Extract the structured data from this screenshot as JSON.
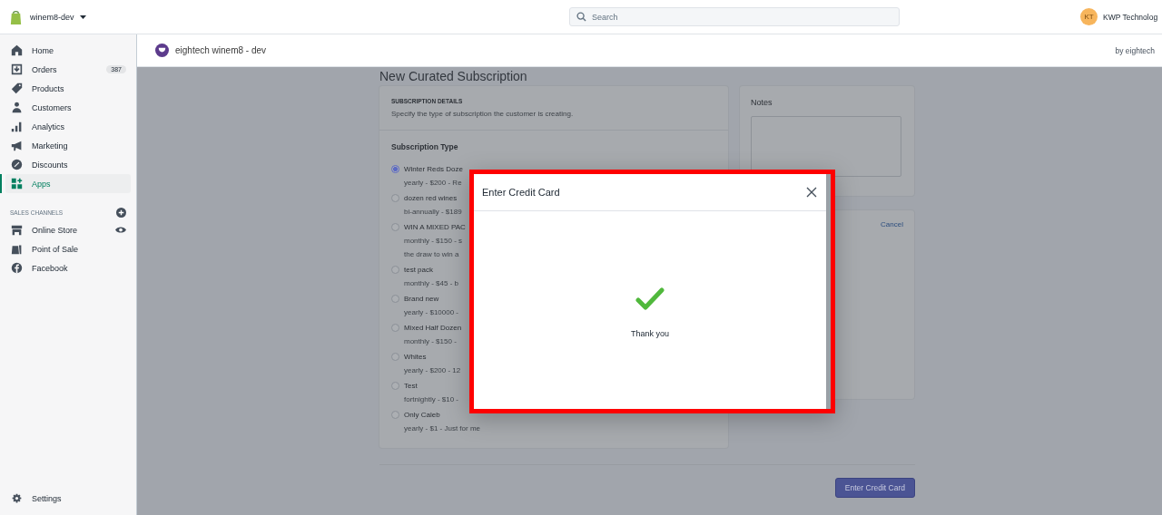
{
  "topbar": {
    "store": "winem8-dev",
    "search": {
      "placeholder": "Search"
    },
    "avatar": "KT",
    "account": "KWP Technolog"
  },
  "sidebar": {
    "items": [
      {
        "label": "Home",
        "selected": false
      },
      {
        "label": "Orders",
        "badge": "387",
        "selected": false
      },
      {
        "label": "Products",
        "selected": false
      },
      {
        "label": "Customers",
        "selected": false
      },
      {
        "label": "Analytics",
        "selected": false
      },
      {
        "label": "Marketing",
        "selected": false
      },
      {
        "label": "Discounts",
        "selected": false
      },
      {
        "label": "Apps",
        "selected": true
      }
    ],
    "section_title": "SALES CHANNELS",
    "channels": [
      {
        "label": "Online Store"
      },
      {
        "label": "Point of Sale"
      },
      {
        "label": "Facebook"
      }
    ],
    "settings": "Settings"
  },
  "app_header": {
    "title": "eightech winem8 - dev",
    "by": "by eightech"
  },
  "page": {
    "title": "New Curated Subscription",
    "details": {
      "heading": "SUBSCRIPTION DETAILS",
      "description": "Specify the type of subscription the customer is creating.",
      "type_label": "Subscription Type",
      "options": [
        {
          "name": "Winter Reds Doze",
          "details": [
            "yearly - $200 - Re"
          ],
          "selected": true
        },
        {
          "name": "dozen red wines",
          "details": [
            "bi-annually - $189"
          ],
          "selected": false
        },
        {
          "name": "WIN A MIXED PAC",
          "details": [
            "monthly - $150 - s",
            "the draw to win a"
          ],
          "selected": false
        },
        {
          "name": "test pack",
          "details": [
            "monthly - $45 - b"
          ],
          "selected": false
        },
        {
          "name": "Brand new",
          "details": [
            "yearly - $10000 -"
          ],
          "selected": false
        },
        {
          "name": "Mixed Half Dozen",
          "details": [
            "monthly - $150 -"
          ],
          "selected": false
        },
        {
          "name": "Whites",
          "details": [
            "yearly - $200 - 12"
          ],
          "selected": false
        },
        {
          "name": "Test",
          "details": [
            "fortnightly - $10 -"
          ],
          "selected": false
        },
        {
          "name": "Only Caleb",
          "details": [
            "yearly - $1 - Just for me"
          ],
          "selected": false
        }
      ]
    },
    "notes": {
      "title": "Notes"
    },
    "customer": {
      "cancel": "Cancel"
    },
    "submit": "Enter Credit Card"
  },
  "modal": {
    "title": "Enter Credit Card",
    "message": "Thank you"
  }
}
